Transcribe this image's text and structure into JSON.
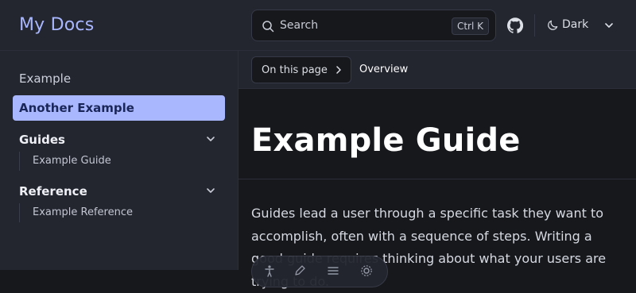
{
  "header": {
    "site_title": "My Docs",
    "search_placeholder": "Search",
    "search_shortcut": "Ctrl K",
    "github_icon": "github-icon",
    "theme_label": "Dark"
  },
  "sidebar": {
    "top_link": "Example",
    "active_link": "Another Example",
    "groups": [
      {
        "label": "Guides",
        "items": [
          "Example Guide"
        ]
      },
      {
        "label": "Reference",
        "items": [
          "Example Reference"
        ]
      }
    ]
  },
  "toc": {
    "button_label": "On this page",
    "current_section": "Overview"
  },
  "main": {
    "title": "Example Guide",
    "paragraph": "Guides lead a user through a specific task they want to accomplish, often with a sequence of steps. Writing a good guide requires thinking about what your users are trying to do."
  },
  "colors": {
    "accent": "#a9b7ff",
    "background": "#17181c",
    "panel": "#23252f"
  }
}
